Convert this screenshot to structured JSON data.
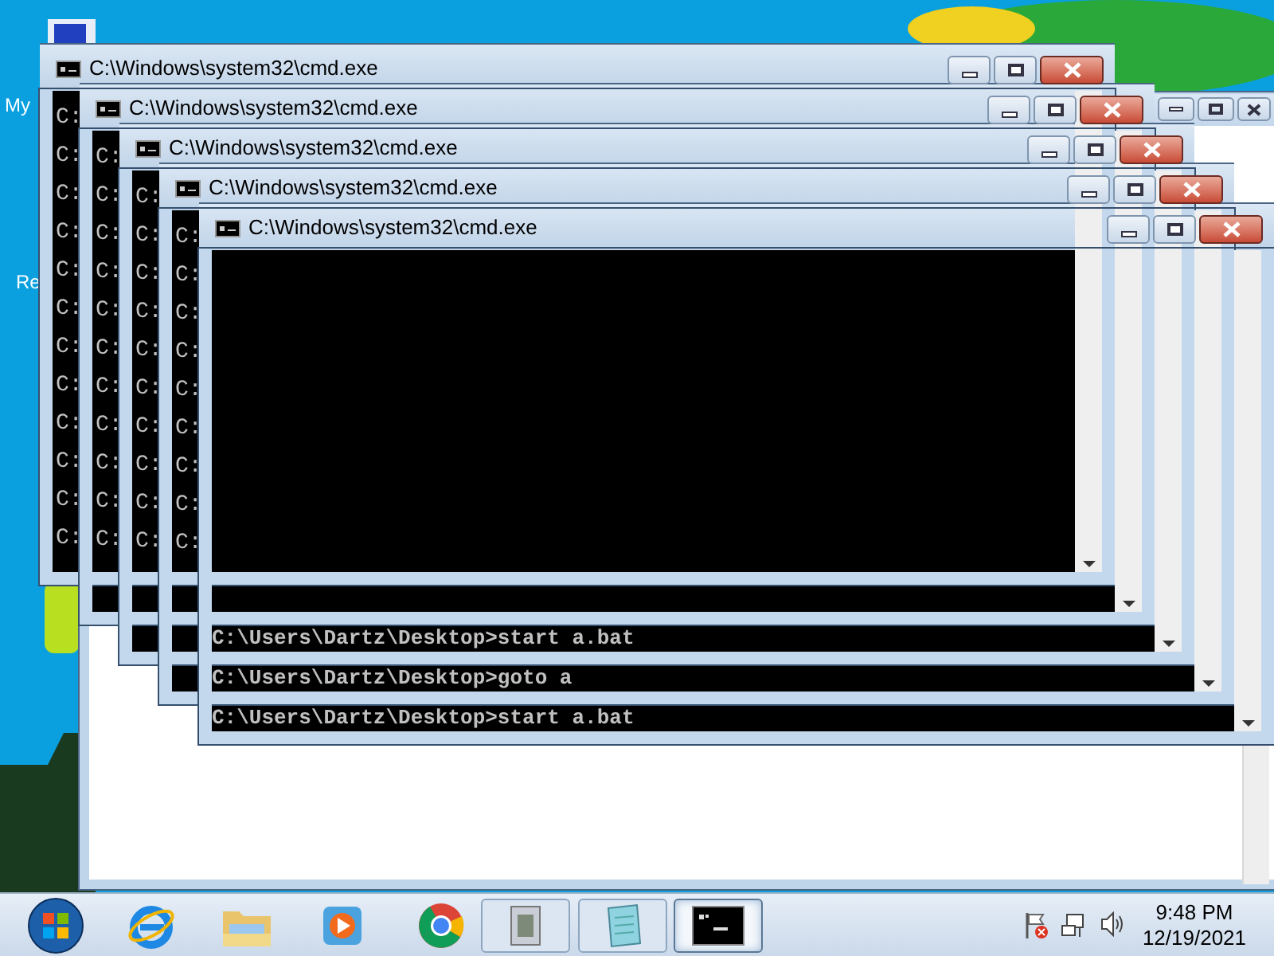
{
  "desktop_icons": [
    {
      "label": "My"
    },
    {
      "label": "Re"
    }
  ],
  "windows": [
    {
      "title": "C:\\Windows\\system32\\cmd.exe",
      "lines": [
        "C:",
        "C:",
        "C:",
        "C:",
        "C:",
        "C:",
        "C:",
        "C:",
        "C:",
        "C:",
        "C:",
        "C:"
      ]
    },
    {
      "title": "C:\\Windows\\system32\\cmd.exe",
      "lines": [
        "C:",
        "C:",
        "C:",
        "C:",
        "C:",
        "C:",
        "C:",
        "C:",
        "C:",
        "C:",
        "C:"
      ]
    },
    {
      "title": "C:\\Windows\\system32\\cmd.exe",
      "lines": [
        "C:",
        "C:",
        "C:",
        "C:",
        "C:",
        "C:",
        "C:",
        "C:",
        "C:",
        "C:"
      ],
      "prompt": "C:\\Users\\Dartz\\Desktop>start a.bat"
    },
    {
      "title": "C:\\Windows\\system32\\cmd.exe",
      "lines": [
        "C:",
        "C:",
        "C:",
        "C:",
        "C:",
        "C:",
        "C:",
        "C:",
        "C:"
      ],
      "prompt": "C:\\Users\\Dartz\\Desktop>goto a"
    },
    {
      "title": "C:\\Windows\\system32\\cmd.exe",
      "prompt": "C:\\Users\\Dartz\\Desktop>start a.bat"
    }
  ],
  "taskbar": {
    "items": [
      {
        "kind": "start"
      },
      {
        "kind": "browser-e"
      },
      {
        "kind": "folder"
      },
      {
        "kind": "media"
      },
      {
        "kind": "chrome"
      },
      {
        "kind": "archive",
        "selected": false
      },
      {
        "kind": "notepad",
        "selected": false
      },
      {
        "kind": "console",
        "selected": true
      }
    ],
    "tray": [
      {
        "kind": "flag"
      },
      {
        "kind": "network"
      },
      {
        "kind": "volume"
      }
    ],
    "clock": {
      "time": "9:48 PM",
      "date": "12/19/2021"
    }
  }
}
